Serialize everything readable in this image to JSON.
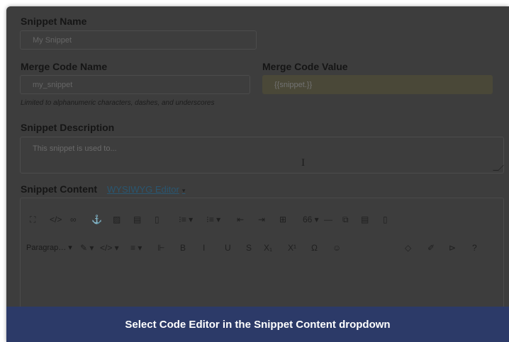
{
  "form": {
    "snippet_name": {
      "label": "Snippet Name",
      "value": "My Snippet"
    },
    "merge_code_name": {
      "label": "Merge Code Name",
      "value": "my_snippet",
      "hint": "Limited to alphanumeric characters, dashes, and underscores"
    },
    "merge_code_value": {
      "label": "Merge Code Value",
      "value": "{{snippet.}}"
    },
    "description": {
      "label": "Snippet Description",
      "placeholder": "This snippet is used to..."
    },
    "content": {
      "label": "Snippet Content",
      "editor_mode": "WYSIWYG Editor",
      "editor_caret": "▾"
    }
  },
  "toolbar": {
    "row1": [
      {
        "icon": "fullscreen-icon",
        "glyph": "⛶"
      },
      {
        "icon": "source-code-icon",
        "glyph": "</>"
      },
      {
        "icon": "link-icon",
        "glyph": "∞"
      },
      {
        "icon": "anchor-icon",
        "glyph": "⚓"
      },
      {
        "icon": "image-icon",
        "glyph": "▨"
      },
      {
        "icon": "media-icon",
        "glyph": "▤"
      },
      {
        "icon": "file-icon",
        "glyph": "▯"
      },
      {
        "icon": "ordered-list-icon",
        "glyph": "⁝≡ ▾"
      },
      {
        "icon": "bullet-list-icon",
        "glyph": "⁝≡ ▾"
      },
      {
        "icon": "outdent-icon",
        "glyph": "⇤"
      },
      {
        "icon": "indent-icon",
        "glyph": "⇥"
      },
      {
        "icon": "table-icon",
        "glyph": "⊞"
      },
      {
        "icon": "blockquote-icon",
        "glyph": "66 ▾"
      },
      {
        "icon": "horizontal-rule-icon",
        "glyph": "—"
      },
      {
        "icon": "external-link-icon",
        "glyph": "⧉"
      },
      {
        "icon": "template-icon",
        "glyph": "▤"
      },
      {
        "icon": "document-icon",
        "glyph": "▯"
      }
    ],
    "row2": [
      {
        "icon": "paragraph-dropdown-icon",
        "glyph": "Paragrap… ▾"
      },
      {
        "icon": "text-color-icon",
        "glyph": "✎ ▾"
      },
      {
        "icon": "code-format-icon",
        "glyph": "</> ▾"
      },
      {
        "icon": "align-icon",
        "glyph": "≡ ▾"
      },
      {
        "icon": "paint-format-icon",
        "glyph": "⊩"
      },
      {
        "icon": "bold-icon",
        "glyph": "B"
      },
      {
        "icon": "italic-icon",
        "glyph": "I"
      },
      {
        "icon": "underline-icon",
        "glyph": "U"
      },
      {
        "icon": "strikethrough-icon",
        "glyph": "S"
      },
      {
        "icon": "subscript-icon",
        "glyph": "X₁"
      },
      {
        "icon": "superscript-icon",
        "glyph": "X¹"
      },
      {
        "icon": "special-char-icon",
        "glyph": "Ω"
      },
      {
        "icon": "emoji-icon",
        "glyph": "☺"
      },
      {
        "icon": "color-drop-icon",
        "glyph": "◇"
      },
      {
        "icon": "highlight-icon",
        "glyph": "✐"
      },
      {
        "icon": "cursor-icon",
        "glyph": "⊳"
      },
      {
        "icon": "help-icon",
        "glyph": "?"
      }
    ]
  },
  "banner": {
    "text": "Select Code Editor in the Snippet Content dropdown"
  },
  "colors": {
    "overlay_panel": "#3d3d3d",
    "banner_bg": "#2c3a68",
    "banner_text": "#ffffff",
    "editor_link": "#2a5670"
  }
}
